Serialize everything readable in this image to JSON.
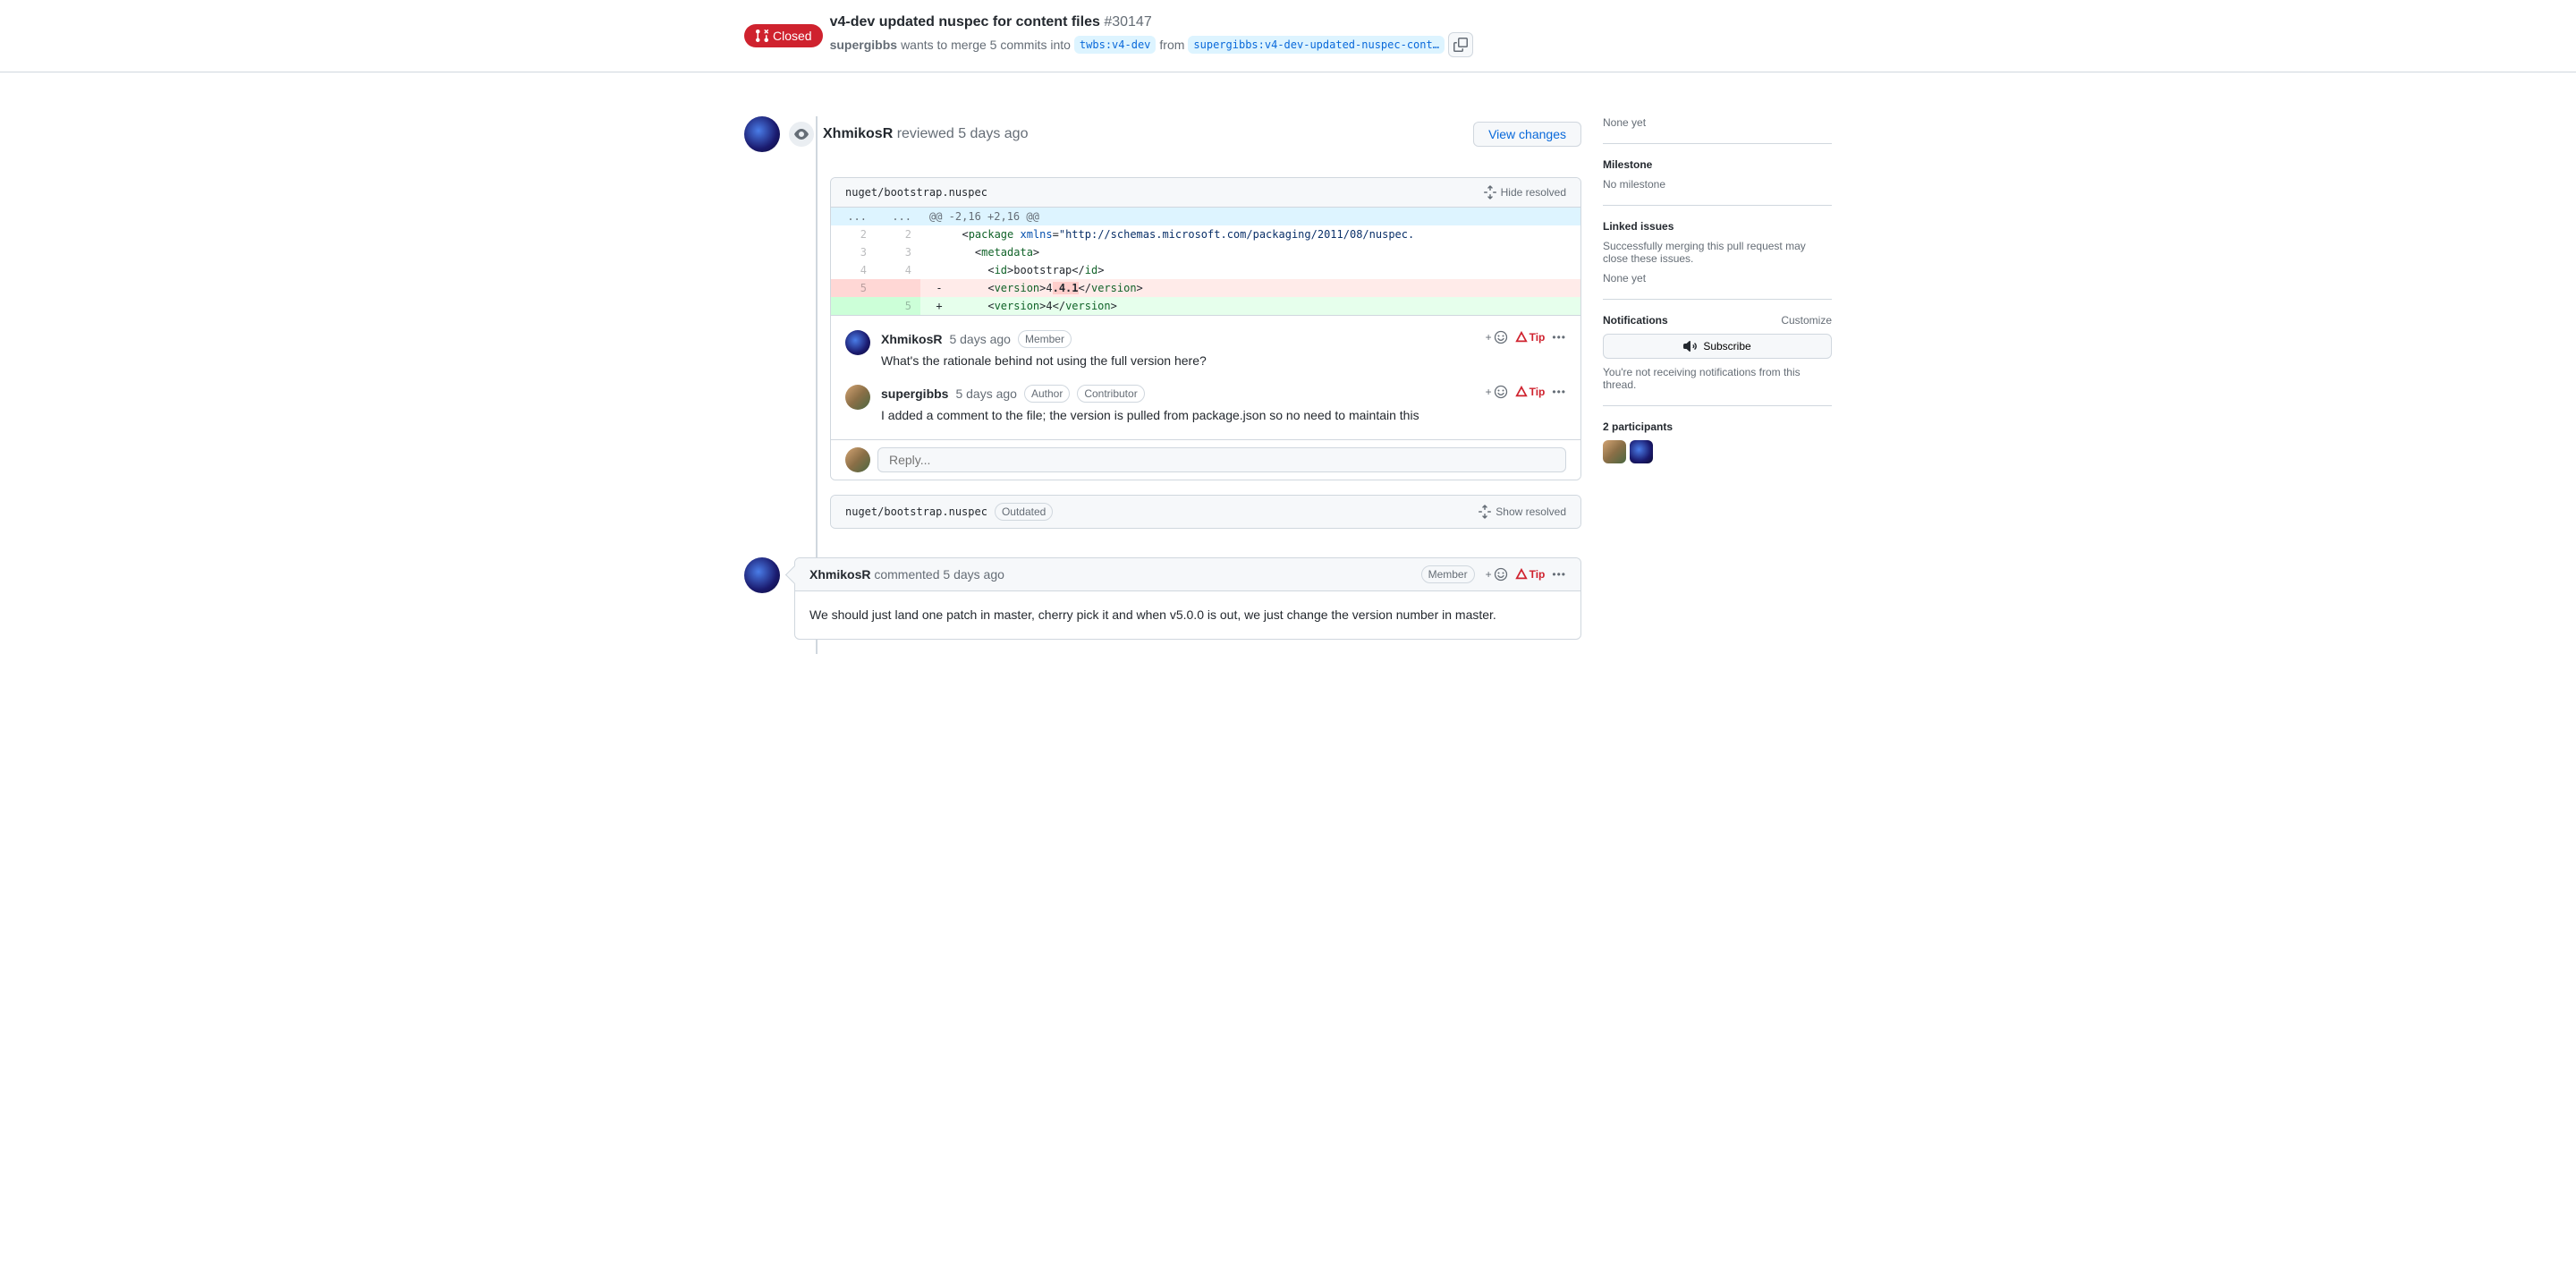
{
  "header": {
    "state": "Closed",
    "title": "v4-dev updated nuspec for content files",
    "number": "#30147",
    "author": "supergibbs",
    "merge_text_1": "wants to merge 5 commits into",
    "base_branch": "twbs:v4-dev",
    "from_text": "from",
    "head_branch": "supergibbs:v4-dev-updated-nuspec-cont…"
  },
  "review": {
    "reviewer": "XhmikosR",
    "action": "reviewed",
    "time": "5 days ago",
    "view_changes": "View changes",
    "file_path": "nuget/bootstrap.nuspec",
    "hide_resolved": "Hide resolved",
    "hunk": "@@ -2,16 +2,16 @@",
    "lines": [
      {
        "l": "2",
        "r": "2",
        "mark": " ",
        "html": "  &lt;<span class='tk-tag'>package</span> <span class='tk-attr'>xmlns</span>=<span class='tk-str'>\"http://schemas.microsoft.com/packaging/2011/08/nuspec.</span>"
      },
      {
        "l": "3",
        "r": "3",
        "mark": " ",
        "html": "    &lt;<span class='tk-tag'>metadata</span>&gt;"
      },
      {
        "l": "4",
        "r": "4",
        "mark": " ",
        "html": "      &lt;<span class='tk-tag'>id</span>&gt;bootstrap&lt;/<span class='tk-tag'>id</span>&gt;"
      },
      {
        "l": "5",
        "r": "",
        "mark": "-",
        "cls": "del-row",
        "html": "      &lt;<span class='tk-tag'>version</span>&gt;4<b style='background:#ffcecb'>.4.1</b>&lt;/<span class='tk-tag'>version</span>&gt;"
      },
      {
        "l": "",
        "r": "5",
        "mark": "+",
        "cls": "add-row",
        "html": "      &lt;<span class='tk-tag'>version</span>&gt;4&lt;/<span class='tk-tag'>version</span>&gt;"
      }
    ],
    "comments": [
      {
        "author": "XhmikosR",
        "time": "5 days ago",
        "badges": [
          "Member"
        ],
        "body": "What's the rationale behind not using the full version here?",
        "avatar": "av-blue"
      },
      {
        "author": "supergibbs",
        "time": "5 days ago",
        "badges": [
          "Author",
          "Contributor"
        ],
        "body": "I added a comment to the file; the version is pulled from package.json so no need to maintain this",
        "avatar": "av-photo"
      }
    ],
    "reply_placeholder": "Reply...",
    "tip": "Tip"
  },
  "outdated_file": {
    "file_path": "nuget/bootstrap.nuspec",
    "label": "Outdated",
    "show_resolved": "Show resolved"
  },
  "timeline_comment": {
    "author": "XhmikosR",
    "action": "commented",
    "time": "5 days ago",
    "badge": "Member",
    "body": "We should just land one patch in master, cherry pick it and when v5.0.0 is out, we just change the version number in master.",
    "tip": "Tip"
  },
  "sidebar": {
    "none_yet": "None yet",
    "milestone_h": "Milestone",
    "milestone_v": "No milestone",
    "linked_h": "Linked issues",
    "linked_desc": "Successfully merging this pull request may close these issues.",
    "linked_v": "None yet",
    "notif_h": "Notifications",
    "customize": "Customize",
    "subscribe": "Subscribe",
    "notif_desc": "You're not receiving notifications from this thread.",
    "participants_h": "2 participants"
  }
}
